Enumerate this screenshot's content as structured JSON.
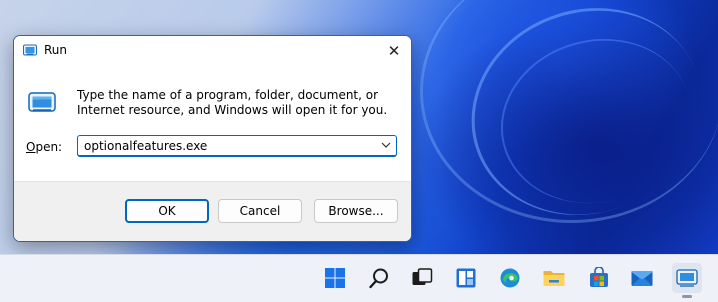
{
  "dialog": {
    "title": "Run",
    "description": "Type the name of a program, folder, document, or Internet resource, and Windows will open it for you.",
    "open_label_accel": "O",
    "open_label_rest": "pen:",
    "input_value": "optionalfeatures.exe",
    "buttons": {
      "ok": "OK",
      "cancel": "Cancel",
      "browse": "Browse..."
    },
    "close_glyph": "✕"
  },
  "icons": {
    "title": "run-icon",
    "close": "close-icon",
    "chevron": "chevron-down-icon"
  },
  "colors": {
    "accent": "#0067c0",
    "footer_bg": "#f0f0f0",
    "taskbar_bg": "#eef1f7"
  },
  "taskbar": {
    "items": [
      {
        "name": "start-icon"
      },
      {
        "name": "search-icon"
      },
      {
        "name": "task-view-icon"
      },
      {
        "name": "widgets-icon"
      },
      {
        "name": "edge-icon"
      },
      {
        "name": "file-explorer-icon"
      },
      {
        "name": "microsoft-store-icon"
      },
      {
        "name": "mail-icon"
      },
      {
        "name": "run-app-icon",
        "active": true
      }
    ]
  }
}
